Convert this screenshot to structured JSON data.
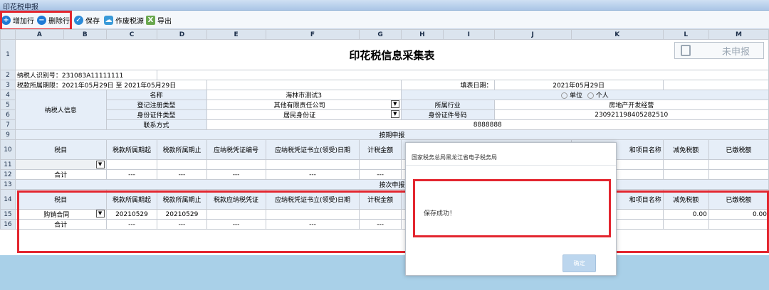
{
  "window": {
    "title": "印花税申报"
  },
  "toolbar": {
    "add_row": "增加行",
    "delete_row": "删除行",
    "save": "保存",
    "void_source": "作废税源",
    "export": "导出"
  },
  "sheet": {
    "col_headers": [
      "A",
      "B",
      "C",
      "D",
      "E",
      "F",
      "G",
      "H",
      "I",
      "J",
      "K",
      "L",
      "M"
    ],
    "row_numbers": [
      "1",
      "2",
      "3",
      "4",
      "5",
      "6",
      "7",
      "9",
      "10",
      "11",
      "12",
      "13",
      "14",
      "15",
      "16"
    ],
    "title": "印花税信息采集表",
    "status": "未申报",
    "taxpayer_id_label": "纳税人识别号：",
    "taxpayer_id": "231083A11111111",
    "period_label": "税款所属期限：",
    "period_value": "2021年05月29日 至 2021年05月29日",
    "fill_date_label": "填表日期：",
    "fill_date": "2021年05月29日",
    "taxpayer_info_label": "纳税人信息",
    "name_label": "名称",
    "name_value": "海林市测试3",
    "unit_option": "单位",
    "person_option": "个人",
    "reg_type_label": "登记注册类型",
    "reg_type_value": "其他有限责任公司",
    "industry_label": "所属行业",
    "industry_value": "房地产开发经营",
    "id_type_label": "身份证件类型",
    "id_type_value": "居民身份证",
    "id_no_label": "身份证件号码",
    "id_no_value": "230921198405282510",
    "contact_label": "联系方式",
    "contact_value": "8888888",
    "section_period": "按期申报",
    "section_times": "按次申报",
    "headers": {
      "tax_item": "税目",
      "period_start": "税款所属期起",
      "period_end": "税款所属期止",
      "voucher_no": "应纳税凭证编号",
      "voucher_date": "应纳税凭证书立(领受)日期",
      "tax_amount": "计税金额",
      "name_item": "和项目名称",
      "exempt": "减免税额",
      "paid": "已缴税额",
      "voucher_short": "税款应纳税凭证"
    },
    "total_label": "合计",
    "dash": "---",
    "row15": {
      "tax_item": "购销合同",
      "start": "20210529",
      "end": "20210529",
      "exempt": "0.00",
      "paid": "0.00"
    }
  },
  "dialog": {
    "title": "国家税务总局黑龙江省电子税务局",
    "message": "保存成功！",
    "ok": "确定"
  },
  "colors": {
    "highlight": "#e3262f",
    "header_bg": "#dbe4ee",
    "label_bg": "#e6eef8"
  }
}
